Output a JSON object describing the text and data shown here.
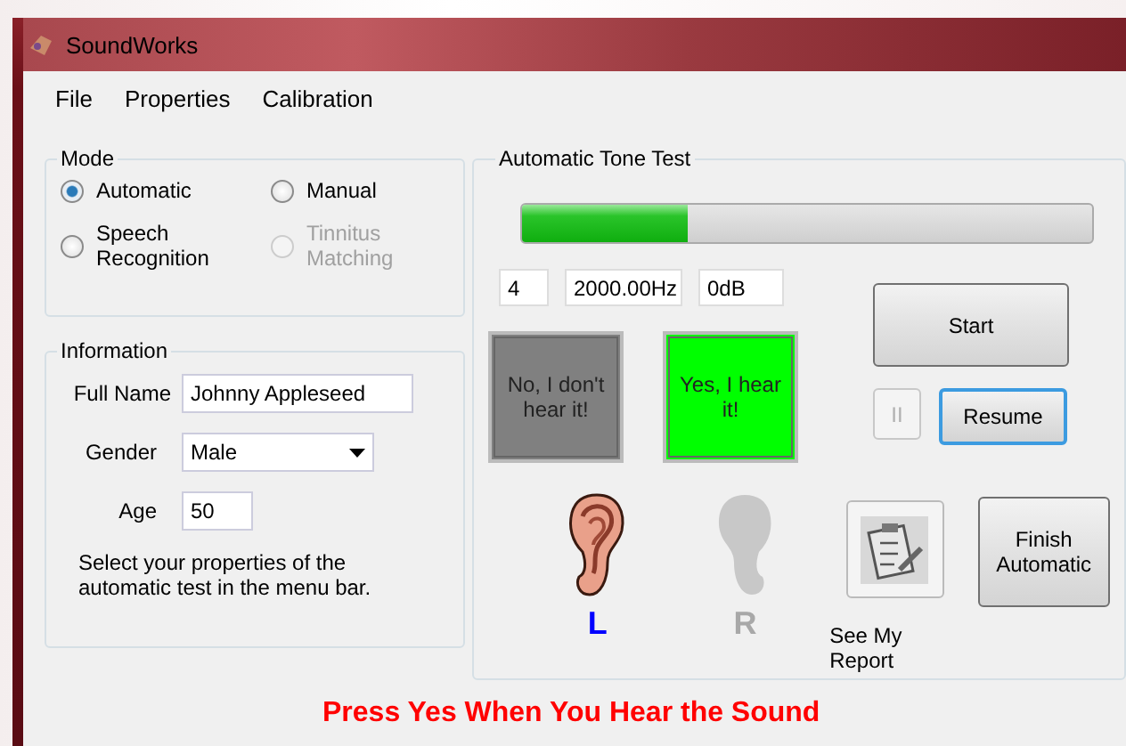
{
  "window": {
    "title": "SoundWorks"
  },
  "menu": [
    "File",
    "Properties",
    "Calibration"
  ],
  "mode": {
    "title": "Mode",
    "options": [
      {
        "label": "Automatic",
        "selected": true,
        "disabled": false
      },
      {
        "label": "Manual",
        "selected": false,
        "disabled": false
      },
      {
        "label": "Speech Recognition",
        "selected": false,
        "disabled": false
      },
      {
        "label": "Tinnitus Matching",
        "selected": false,
        "disabled": true
      }
    ]
  },
  "information": {
    "title": "Information",
    "fields": [
      {
        "kind": "text",
        "label": "Full Name",
        "value": "Johnny Appleseed"
      },
      {
        "kind": "dropdown",
        "label": "Gender",
        "value": "Male"
      },
      {
        "kind": "short",
        "label": "Age",
        "value": "50"
      }
    ],
    "note": "Select your properties of the automatic test in the menu bar."
  },
  "tone_test": {
    "title": "Automatic Tone Test",
    "progress": {
      "level": 0.29
    },
    "readouts": [
      "4",
      "2000.00Hz",
      "0dB"
    ],
    "answers": [
      {
        "label": "No, I don't hear it!",
        "color": "#808080"
      },
      {
        "label": "Yes, I hear it!",
        "color": "#00ff00"
      }
    ],
    "start_button": "Start",
    "pause_button": {
      "label": "II",
      "disabled": true
    },
    "resume_button": {
      "label": "Resume",
      "focused": true
    },
    "ears": [
      {
        "label": "L",
        "active": true
      },
      {
        "label": "R",
        "active": false
      }
    ],
    "report_label": "See My Report",
    "finish_button": "Finish Automatic"
  },
  "instruction": "Press Yes When You Hear the Sound"
}
